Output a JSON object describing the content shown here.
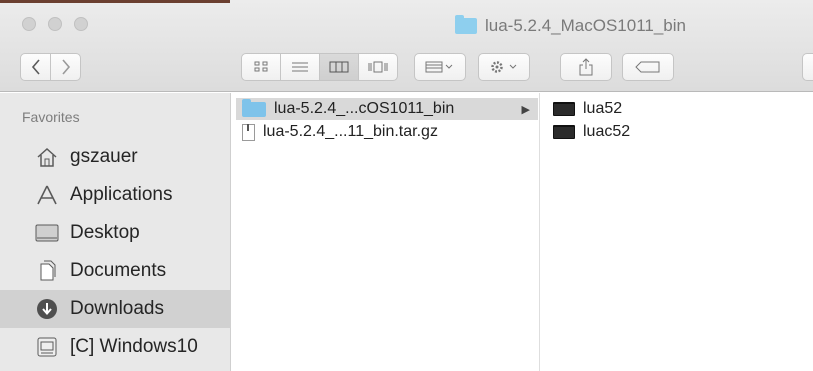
{
  "window": {
    "title": "lua-5.2.4_MacOS1011_bin",
    "title_icon": "folder-icon"
  },
  "toolbar": {
    "back_icon": "chevron-left-icon",
    "forward_icon": "chevron-right-icon",
    "view_modes": [
      "icon-view-icon",
      "list-view-icon",
      "column-view-icon",
      "cover-flow-icon"
    ],
    "active_view": "column-view-icon",
    "arrange_icon": "arrange-icon",
    "action_icon": "gear-icon",
    "share_icon": "share-icon",
    "tags_icon": "tag-icon"
  },
  "sidebar": {
    "heading": "Favorites",
    "items": [
      {
        "label": "gszauer",
        "icon": "home-icon"
      },
      {
        "label": "Applications",
        "icon": "applications-icon"
      },
      {
        "label": "Desktop",
        "icon": "desktop-icon"
      },
      {
        "label": "Documents",
        "icon": "documents-icon"
      },
      {
        "label": "Downloads",
        "icon": "downloads-icon",
        "selected": true
      },
      {
        "label": "[C] Windows10",
        "icon": "drive-icon"
      }
    ]
  },
  "columns": [
    {
      "items": [
        {
          "name": "lua-5.2.4_...cOS1011_bin",
          "icon": "folder-icon",
          "selected": true
        },
        {
          "name": "lua-5.2.4_...11_bin.tar.gz",
          "icon": "archive-icon"
        }
      ]
    },
    {
      "items": [
        {
          "name": "lua52",
          "icon": "executable-icon"
        },
        {
          "name": "luac52",
          "icon": "executable-icon"
        }
      ]
    }
  ],
  "colors": {
    "folder": "#8ecfee",
    "selection": "#d1d1d1",
    "sidebar_bg": "#e8e8e8"
  }
}
